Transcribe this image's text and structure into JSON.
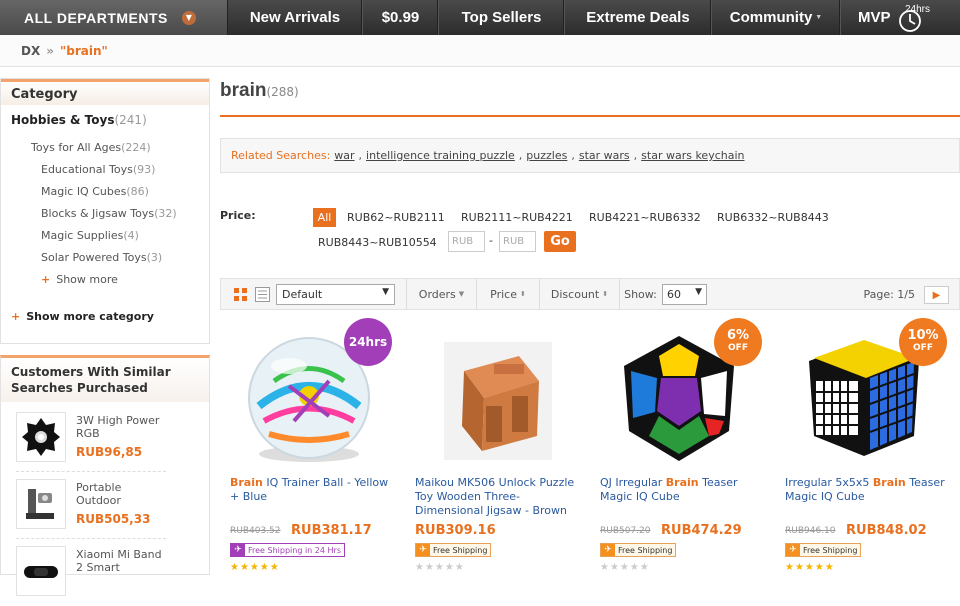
{
  "nav": {
    "all_departments": "ALL DEPARTMENTS",
    "items": [
      "New Arrivals",
      "$0.99",
      "Top Sellers",
      "Extreme Deals",
      "Community",
      "MVP"
    ],
    "badge_24": "24hrs"
  },
  "breadcrumb": {
    "home": "DX",
    "sep": "»",
    "query": "\"brain\""
  },
  "category": {
    "title": "Category",
    "top": {
      "label": "Hobbies & Toys",
      "count": "(241)"
    },
    "lv1": {
      "label": "Toys for All Ages",
      "count": "(224)"
    },
    "lv2": [
      {
        "label": "Educational Toys",
        "count": "(93)"
      },
      {
        "label": "Magic IQ Cubes",
        "count": "(86)"
      },
      {
        "label": "Blocks & Jigsaw Toys",
        "count": "(32)"
      },
      {
        "label": "Magic Supplies",
        "count": "(4)"
      },
      {
        "label": "Solar Powered Toys",
        "count": "(3)"
      }
    ],
    "show_more": "Show more",
    "show_more_category": "Show more category"
  },
  "customers": {
    "title": "Customers With Similar Searches Purchased",
    "items": [
      {
        "name": "3W High Power RGB",
        "price": "RUB96,85"
      },
      {
        "name": "Portable Outdoor",
        "price": "RUB505,33"
      },
      {
        "name": "Xiaomi Mi Band 2 Smart",
        "price": ""
      }
    ]
  },
  "results": {
    "query": "brain",
    "count": "(288)"
  },
  "related": {
    "label": "Related Searches:",
    "terms": [
      "war",
      "intelligence training puzzle",
      "puzzles",
      "star wars",
      "star wars keychain"
    ],
    "comma": ","
  },
  "price": {
    "label": "Price:",
    "all": "All",
    "ranges": [
      "RUB62~RUB2111",
      "RUB2111~RUB4221",
      "RUB4221~RUB6332",
      "RUB6332~RUB8443",
      "RUB8443~RUB10554"
    ],
    "min_placeholder": "RUB",
    "max_placeholder": "RUB",
    "dash": "-",
    "go": "Go"
  },
  "sortbar": {
    "sort_value": "Default",
    "orders": "Orders",
    "price": "Price",
    "discount": "Discount",
    "show_label": "Show:",
    "show_value": "60",
    "page_label": "Page: 1/5"
  },
  "products": [
    {
      "pre": "",
      "hl": "Brain",
      "post": " IQ Trainer Ball - Yellow + Blue",
      "old": "RUB403.52",
      "price": "RUB381.17",
      "shipping": "Free Shipping in 24 Hrs",
      "badge": "24hrs",
      "badge_sub": ""
    },
    {
      "pre": "Maikou MK506 Unlock Puzzle Toy Wooden Three-Dimensional Jigsaw - Brown",
      "hl": "",
      "post": "",
      "old": "",
      "price": "RUB309.16",
      "shipping": "Free Shipping",
      "badge": "",
      "badge_sub": ""
    },
    {
      "pre": "QJ Irregular ",
      "hl": "Brain",
      "post": " Teaser Magic IQ Cube",
      "old": "RUB507.20",
      "price": "RUB474.29",
      "shipping": "Free Shipping",
      "badge": "6%",
      "badge_sub": "OFF"
    },
    {
      "pre": "Irregular 5x5x5 ",
      "hl": "Brain",
      "post": " Teaser Magic IQ Cube",
      "old": "RUB946.10",
      "price": "RUB848.02",
      "shipping": "Free Shipping",
      "badge": "10%",
      "badge_sub": "OFF"
    }
  ],
  "colors": {
    "accent": "#e8701f",
    "link": "#2a5a9e",
    "purple": "#a23fb8"
  }
}
